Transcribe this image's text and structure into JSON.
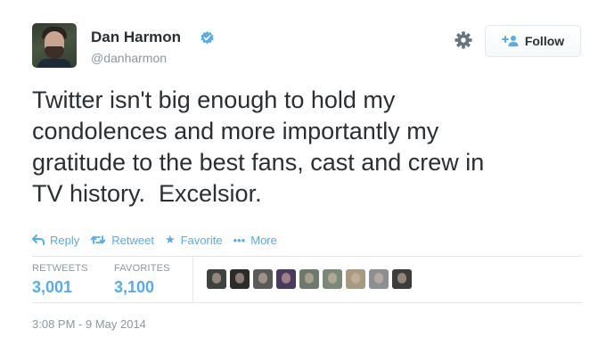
{
  "user": {
    "name": "Dan Harmon",
    "handle": "@danharmon",
    "avatar_icon": "user-avatar",
    "verified_icon": "verified-badge-icon",
    "verified_color": "#55acee"
  },
  "header": {
    "settings_icon": "gear-icon",
    "follow_label": "Follow",
    "follow_icon": "add-user-icon"
  },
  "tweet": {
    "text": "Twitter isn't big enough to hold my\ncondolences and more importantly my\ngratitude to the best fans, cast and crew in\nTV history.  Excelsior."
  },
  "actions": [
    {
      "label": "Reply",
      "icon": "reply-icon"
    },
    {
      "label": "Retweet",
      "icon": "retweet-icon"
    },
    {
      "label": "Favorite",
      "icon": "star-icon"
    },
    {
      "label": "More",
      "icon": "more-icon"
    }
  ],
  "stats": {
    "retweets_label": "RETWEETS",
    "retweets_value": "3,001",
    "favorites_label": "FAVORITES",
    "favorites_value": "3,100"
  },
  "favoriters": [
    {
      "icon": "favoriter-avatar",
      "color": "#3d4440"
    },
    {
      "icon": "favoriter-avatar",
      "color": "#2b2b2b"
    },
    {
      "icon": "favoriter-avatar",
      "color": "#5a5a5a"
    },
    {
      "icon": "favoriter-avatar",
      "color": "#4a3a5e"
    },
    {
      "icon": "favoriter-avatar",
      "color": "#6b7a6a"
    },
    {
      "icon": "favoriter-avatar",
      "color": "#7a8a78"
    },
    {
      "icon": "favoriter-avatar",
      "color": "#a69a80"
    },
    {
      "icon": "favoriter-avatar",
      "color": "#8a8f92"
    },
    {
      "icon": "favoriter-avatar",
      "color": "#3c3c3c"
    }
  ],
  "timestamp": "3:08 PM - 9 May 2014",
  "colors": {
    "accent": "#55acee",
    "text": "#292f33",
    "muted": "#8899a6",
    "border": "#e1e8ed"
  }
}
